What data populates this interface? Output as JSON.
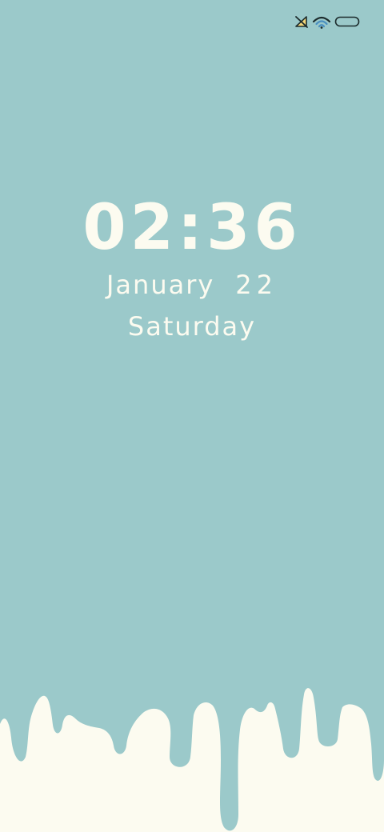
{
  "colors": {
    "background": "#9BC9CA",
    "cream": "#FCFBF0",
    "icon_outline": "#1C2B2C",
    "icon_yellow": "#F5D77A",
    "icon_blue": "#4A8FC0"
  },
  "status_bar": {
    "icons": [
      "no-signal-icon",
      "wifi-icon",
      "battery-icon"
    ]
  },
  "lockscreen": {
    "time": "02:36",
    "month": "January",
    "day": "22",
    "weekday": "Saturday"
  },
  "wallpaper": {
    "decoration": "dripping-cream"
  }
}
